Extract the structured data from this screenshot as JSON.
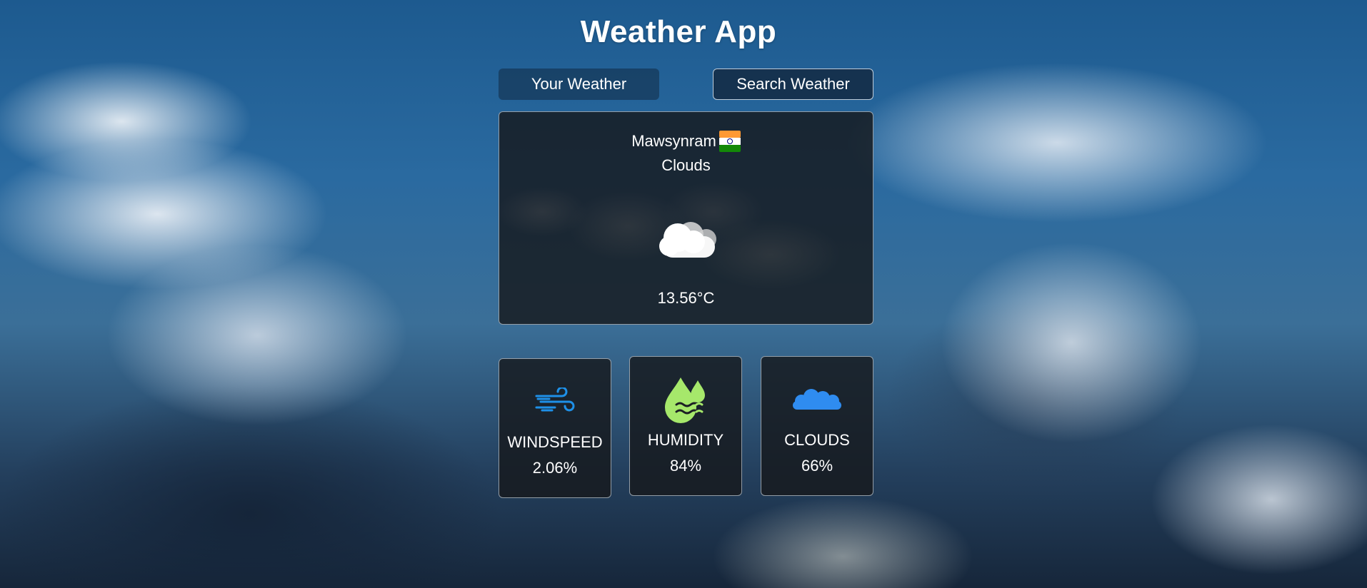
{
  "app": {
    "title": "Weather App"
  },
  "tabs": [
    {
      "label": "Your Weather",
      "active": true
    },
    {
      "label": "Search Weather",
      "active": false
    }
  ],
  "current": {
    "city": "Mawsynram",
    "country_flag": "india-flag-icon",
    "condition": "Clouds",
    "condition_icon": "cloud-icon",
    "temperature": "13.56°C"
  },
  "stats": {
    "windspeed": {
      "label": "WINDSPEED",
      "value": "2.06%",
      "icon": "wind-icon",
      "color": "#1e90e8"
    },
    "humidity": {
      "label": "HUMIDITY",
      "value": "84%",
      "icon": "humidity-drops-icon",
      "color": "#a6e86b"
    },
    "clouds": {
      "label": "CLOUDS",
      "value": "66%",
      "icon": "cloud-icon",
      "color": "#2f8cf0"
    }
  }
}
